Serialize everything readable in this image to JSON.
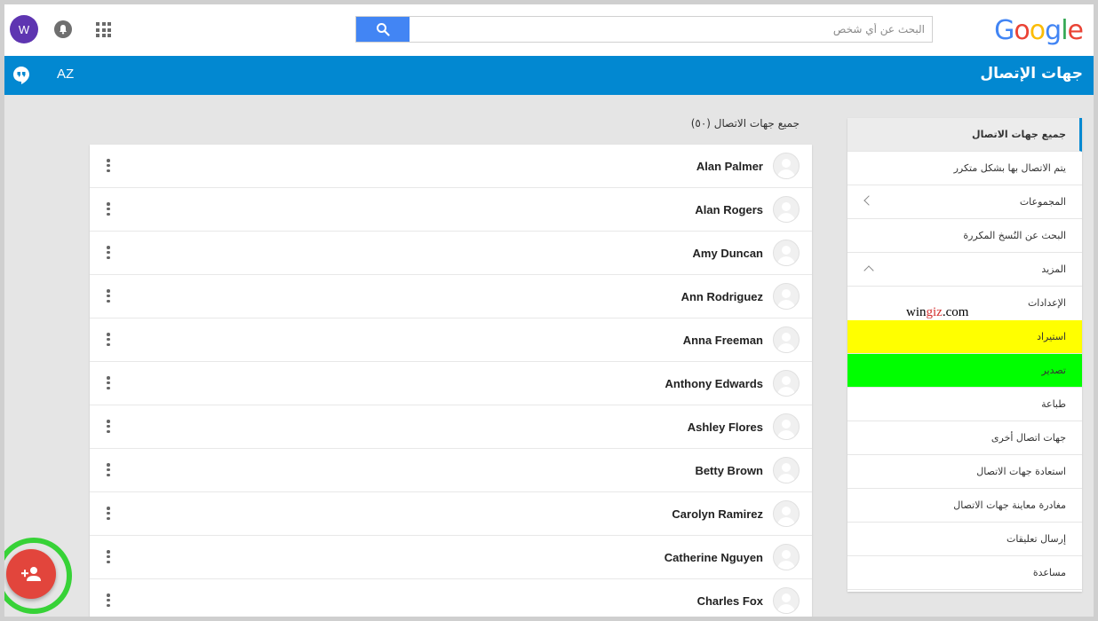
{
  "header": {
    "logo_text": "Google",
    "logo_colors": [
      "#4285f4",
      "#ea4335",
      "#fbbc05",
      "#4285f4",
      "#34a853",
      "#ea4335"
    ],
    "search_placeholder": "البحث عن أي شخص",
    "avatar_letter": "W"
  },
  "bluebar": {
    "title": "جهات الإتصال",
    "sort_label": "AZ"
  },
  "sidebar": {
    "items": [
      {
        "label": "جميع جهات الاتصال",
        "state": "active"
      },
      {
        "label": "يتم الاتصال بها بشكل متكرر"
      },
      {
        "label": "المجموعات",
        "chevron": "left"
      },
      {
        "label": "البحث عن النُسخ المكررة"
      },
      {
        "label": "المزيد",
        "chevron": "up"
      },
      {
        "label": "الإعدادات",
        "sub": true
      },
      {
        "label": "استيراد",
        "highlight": "#ffff00"
      },
      {
        "label": "تصدير",
        "highlight": "#00ff00"
      },
      {
        "label": "طباعة"
      },
      {
        "label": "جهات اتصال أخرى"
      },
      {
        "label": "استعادة جهات الاتصال"
      },
      {
        "label": "مغادرة معاينة جهات الاتصال"
      },
      {
        "label": "إرسال تعليقات"
      },
      {
        "label": "مساعدة"
      }
    ]
  },
  "watermark": {
    "part1": "win",
    "part2": "giz",
    "part3": ".com"
  },
  "main": {
    "count_title": "جميع جهات الاتصال (٥٠)",
    "contacts": [
      "Alan Palmer",
      "Alan Rogers",
      "Amy Duncan",
      "Ann Rodriguez",
      "Anna Freeman",
      "Anthony Edwards",
      "Ashley Flores",
      "Betty Brown",
      "Carolyn Ramirez",
      "Catherine Nguyen",
      "Charles Fox"
    ]
  },
  "colors": {
    "accent_blue": "#0288d1",
    "fab_red": "#e2453c",
    "fab_ring_green": "#37d237",
    "search_blue": "#4285f4"
  }
}
